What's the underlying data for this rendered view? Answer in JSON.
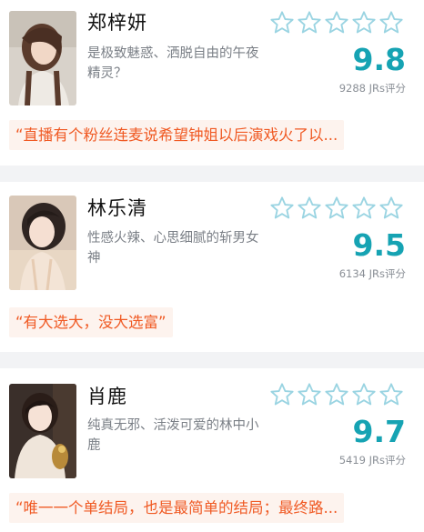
{
  "colors": {
    "score": "#16a3b3",
    "quote_text": "#f05a24",
    "quote_bg": "#fdf3ee",
    "star_outline": "#9ad4e2"
  },
  "star_icon": "star-outline-icon",
  "cards": [
    {
      "name": "郑梓妍",
      "description": "是极致魅惑、洒脱自由的午夜精灵？",
      "score": "9.8",
      "rating_count": "9288 JRs评分",
      "quote": "“直播有个粉丝连麦说希望钟姐以后演戏火了以..."
    },
    {
      "name": "林乐清",
      "description": "性感火辣、心思细腻的斩男女神",
      "score": "9.5",
      "rating_count": "6134 JRs评分",
      "quote": "“有大选大，没大选富”"
    },
    {
      "name": "肖鹿",
      "description": "纯真无邪、活泼可爱的林中小鹿",
      "score": "9.7",
      "rating_count": "5419 JRs评分",
      "quote": "“唯一一个单结局，也是最简单的结局；最终路..."
    }
  ]
}
